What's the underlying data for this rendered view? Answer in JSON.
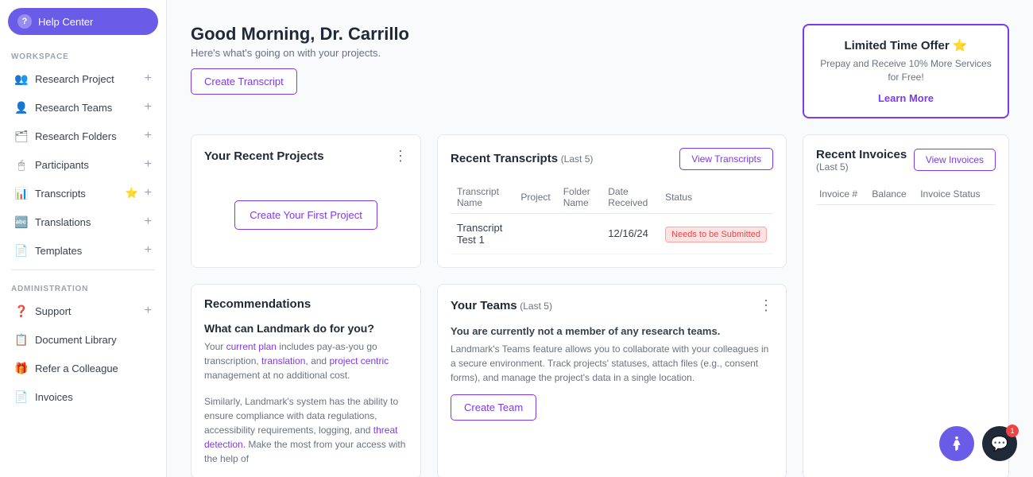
{
  "sidebar": {
    "help_center": "Help Center",
    "workspace_label": "WORKSPACE",
    "administration_label": "ADMINISTRATION",
    "items": [
      {
        "id": "research-project",
        "label": "Research Project",
        "icon": "👥",
        "has_add": true
      },
      {
        "id": "research-teams",
        "label": "Research Teams",
        "icon": "👤",
        "has_add": true
      },
      {
        "id": "research-folders",
        "label": "Research Folders",
        "icon": "🗂",
        "has_add": true
      },
      {
        "id": "participants",
        "label": "Participants",
        "icon": "🖱",
        "has_add": true
      },
      {
        "id": "transcripts",
        "label": "Transcripts",
        "icon": "📊",
        "star": true,
        "has_add": true
      },
      {
        "id": "translations",
        "label": "Translations",
        "icon": "🔤",
        "has_add": true
      },
      {
        "id": "templates",
        "label": "Templates",
        "icon": "📄",
        "has_add": true
      }
    ],
    "admin_items": [
      {
        "id": "support",
        "label": "Support",
        "icon": "❓",
        "has_add": true
      },
      {
        "id": "document-library",
        "label": "Document Library",
        "icon": "📋",
        "has_add": false
      },
      {
        "id": "refer-colleague",
        "label": "Refer a Colleague",
        "icon": "🎁",
        "has_add": false
      },
      {
        "id": "invoices",
        "label": "Invoices",
        "icon": "📄",
        "has_add": false
      }
    ]
  },
  "header": {
    "greeting": "Good Morning, Dr. Carrillo",
    "subtitle": "Here's what's going on with your projects.",
    "create_transcript_label": "Create Transcript"
  },
  "promo": {
    "title": "Limited Time Offer",
    "description": "Prepay and Receive 10% More Services for Free!",
    "learn_more": "Learn More"
  },
  "recent_projects": {
    "title": "Your Recent Projects",
    "create_first_label": "Create Your First Project"
  },
  "recent_transcripts": {
    "title": "Recent Transcripts",
    "subtitle": "(Last 5)",
    "view_btn": "View Transcripts",
    "columns": [
      "Transcript Name",
      "Project",
      "Folder Name",
      "Date Received",
      "Status"
    ],
    "rows": [
      {
        "name": "Transcript Test 1",
        "project": "",
        "folder": "",
        "date": "12/16/24",
        "status": "Needs to be Submitted"
      }
    ]
  },
  "recommendations": {
    "section_title": "Recommendations",
    "what_title": "What can Landmark do for you?",
    "para1": "Your current plan includes pay-as-you go transcription, translation, and project centric management at no additional cost.",
    "para2": "Similarly, Landmark's system has the ability to ensure compliance with data regulations, accessibility requirements, logging, and threat detection. Make the most from your access with the help of"
  },
  "teams": {
    "title": "Your Teams",
    "subtitle": "(Last 5)",
    "empty_title": "You are currently not a member of any research teams.",
    "description": "Landmark's Teams feature allows you to collaborate with your colleagues in a secure environment. Track projects' statuses, attach files (e.g., consent forms), and manage the project's data in a single location.",
    "create_team_label": "Create Team"
  },
  "invoices": {
    "title": "Recent Invoices",
    "subtitle": "(Last 5)",
    "view_btn": "View Invoices",
    "columns": [
      "Invoice #",
      "Balance",
      "Invoice Status"
    ]
  },
  "floats": {
    "accessibility_label": "Accessibility",
    "chat_label": "Chat",
    "chat_badge": "1"
  }
}
